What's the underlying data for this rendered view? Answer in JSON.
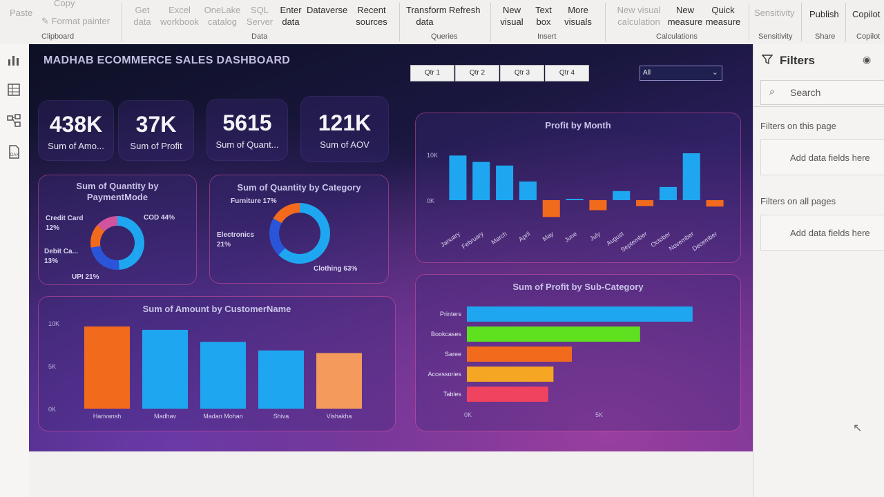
{
  "ribbon": {
    "clipboard": {
      "paste": "Paste",
      "copy": "Copy",
      "format_painter": "Format painter",
      "group": "Clipboard"
    },
    "data": {
      "get_data": "Get data",
      "excel": "Excel workbook",
      "onelake": "OneLake catalog",
      "sql": "SQL Server",
      "enter": "Enter data",
      "dataverse": "Dataverse",
      "recent": "Recent sources",
      "group": "Data"
    },
    "queries": {
      "transform": "Transform data",
      "refresh": "Refresh",
      "group": "Queries"
    },
    "insert": {
      "new_visual": "New visual",
      "text_box": "Text box",
      "more_visuals": "More visuals",
      "group": "Insert"
    },
    "calculations": {
      "new_visual_calc": "New visual calculation",
      "new_measure": "New measure",
      "quick_measure": "Quick measure",
      "group": "Calculations"
    },
    "sensitivity": {
      "label": "Sensitivity",
      "group": "Sensitivity"
    },
    "share": {
      "publish": "Publish",
      "group": "Share"
    },
    "copilot": {
      "label": "Copilot",
      "group": "Copilot"
    }
  },
  "dashboard": {
    "title": "MADHAB ECOMMERCE SALES DASHBOARD",
    "quarters": [
      "Qtr 1",
      "Qtr 2",
      "Qtr 3",
      "Qtr 4"
    ],
    "slicer_value": "All",
    "kpis": [
      {
        "value": "438K",
        "label": "Sum of Amo..."
      },
      {
        "value": "37K",
        "label": "Sum of Profit"
      },
      {
        "value": "5615",
        "label": "Sum of Quant..."
      },
      {
        "value": "121K",
        "label": "Sum of AOV"
      }
    ],
    "colors": {
      "blue": "#1ea7f0",
      "orange": "#f26b1d",
      "green": "#5ee11e",
      "yellow": "#f5a623",
      "red": "#f0435f",
      "pink": "#d0559e",
      "navy": "#2b55d8"
    }
  },
  "chart_data": [
    {
      "type": "pie",
      "title": "Sum of Quantity by PaymentMode",
      "labels": [
        "COD 44%",
        "UPI 21%",
        "Debit Ca... 13%",
        "Credit Card 12%"
      ],
      "categories": [
        "COD",
        "UPI",
        "Debit Card",
        "Credit Card"
      ],
      "values": [
        44,
        21,
        13,
        12
      ]
    },
    {
      "type": "pie",
      "title": "Sum of Quantity by Category",
      "labels": [
        "Clothing 63%",
        "Electronics 21%",
        "Furniture 17%"
      ],
      "categories": [
        "Clothing",
        "Electronics",
        "Furniture"
      ],
      "values": [
        63,
        21,
        17
      ]
    },
    {
      "type": "bar",
      "title": "Profit by Month",
      "categories": [
        "January",
        "February",
        "March",
        "April",
        "May",
        "June",
        "July",
        "August",
        "September",
        "October",
        "November",
        "December"
      ],
      "values": [
        9800,
        8400,
        7600,
        4100,
        -3700,
        300,
        -2200,
        2000,
        -1300,
        2900,
        10300,
        -1400
      ],
      "yticks": [
        "10K",
        "0K"
      ],
      "ylim": [
        -5000,
        12000
      ]
    },
    {
      "type": "bar",
      "orientation": "horizontal",
      "title": "Sum of Profit by Sub-Category",
      "categories": [
        "Printers",
        "Bookcases",
        "Saree",
        "Accessories",
        "Tables"
      ],
      "values": [
        8600,
        6600,
        4000,
        3300,
        3100
      ],
      "xticks": [
        "0K",
        "5K"
      ],
      "xlim": [
        0,
        10000
      ]
    },
    {
      "type": "bar",
      "title": "Sum of Amount by CustomerName",
      "categories": [
        "Harivansh",
        "Madhav",
        "Madan Mohan",
        "Shiva",
        "Vishakha"
      ],
      "values": [
        9600,
        9200,
        7800,
        6800,
        6500
      ],
      "yticks": [
        "10K",
        "5K",
        "0K"
      ],
      "ylim": [
        0,
        10000
      ]
    }
  ],
  "filters": {
    "title": "Filters",
    "search_placeholder": "Search",
    "on_page": "Filters on this page",
    "on_page_add": "Add data fields here",
    "all_pages": "Filters on all pages",
    "all_pages_add": "Add data fields here"
  }
}
